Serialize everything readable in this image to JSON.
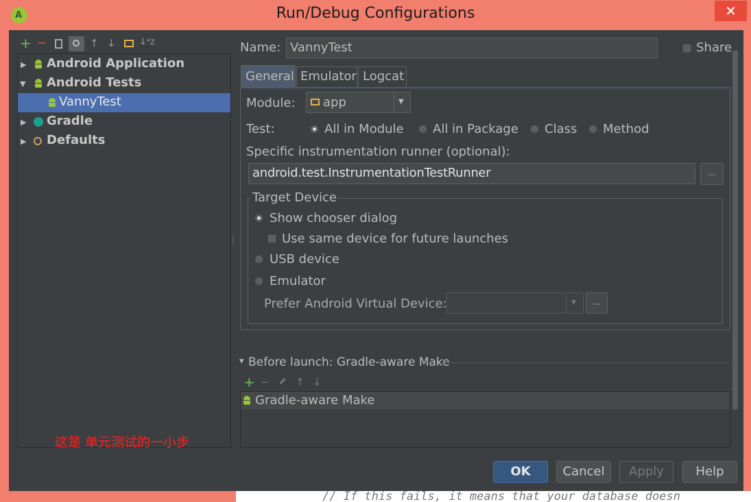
{
  "window": {
    "title": "Run/Debug Configurations",
    "close_glyph": "✕"
  },
  "toolbar": {
    "add": "+",
    "remove": "−",
    "up": "↑",
    "down": "↓",
    "sort": "↓ᵃz"
  },
  "tree": {
    "items": [
      {
        "label": "Android Application",
        "expanded": false
      },
      {
        "label": "Android Tests",
        "expanded": true
      },
      {
        "label": "VannyTest",
        "selected": true
      },
      {
        "label": "Gradle",
        "expanded": false
      },
      {
        "label": "Defaults",
        "expanded": false
      }
    ],
    "triangle_collapsed": "▶",
    "triangle_expanded": "▼"
  },
  "annotation": "这是 单元测试的一小步",
  "name": {
    "label": "Name:",
    "value": "VannyTest"
  },
  "share": {
    "label": "Share",
    "checked": false
  },
  "tabs": [
    {
      "label": "General",
      "active": true
    },
    {
      "label": "Emulator"
    },
    {
      "label": "Logcat"
    }
  ],
  "module": {
    "label": "Module:",
    "value": "app",
    "arrow": "▼"
  },
  "test": {
    "label": "Test:",
    "options": [
      "All in Module",
      "All in Package",
      "Class",
      "Method"
    ],
    "selected": "All in Module"
  },
  "runner": {
    "label": "Specific instrumentation runner (optional):",
    "value": "android.test.InstrumentationTestRunner",
    "browse": "..."
  },
  "target": {
    "legend": "Target Device",
    "show_chooser": "Show chooser dialog",
    "same_device": "Use same device for future launches",
    "usb": "USB device",
    "emulator": "Emulator",
    "prefer_label": "Prefer Android Virtual Device:",
    "prefer_value": "",
    "arrow": "▼",
    "browse": "..."
  },
  "before_launch": {
    "header": "Before launch: Gradle-aware Make",
    "item": "Gradle-aware Make",
    "collapse": "▾"
  },
  "buttons": {
    "ok": "OK",
    "cancel": "Cancel",
    "apply": "Apply",
    "help": "Help"
  },
  "background_code": "// If this fails, it means that your database doesn"
}
